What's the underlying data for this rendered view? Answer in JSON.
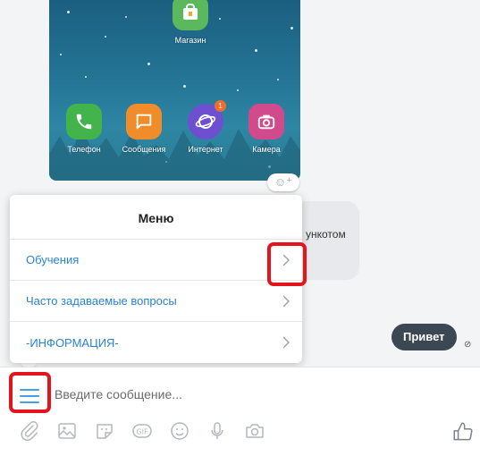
{
  "apps": [
    {
      "label": "Магазин",
      "icon": "store-icon",
      "color": "#5cb85c"
    },
    {
      "label": "Телефон",
      "icon": "phone-icon",
      "color": "#43b34b"
    },
    {
      "label": "Сообщения",
      "icon": "messages-icon",
      "color": "#f08c2a"
    },
    {
      "label": "Интернет",
      "icon": "internet-icon",
      "color": "#6e4fd0",
      "badge": "1"
    },
    {
      "label": "Камера",
      "icon": "camera-icon",
      "color": "#d14a8c"
    }
  ],
  "bot_message": {
    "text": "ункотом"
  },
  "my_message": {
    "text": "Привет"
  },
  "menu": {
    "title": "Меню",
    "items": [
      {
        "label": "Обучения"
      },
      {
        "label": "Часто задаваемые вопросы"
      },
      {
        "label": "-ИНФОРМАЦИЯ-"
      }
    ]
  },
  "composer": {
    "placeholder": "Введите сообщение...",
    "tools": [
      "paperclip-icon",
      "image-icon",
      "sticker-icon",
      "gif-icon",
      "emoji-icon",
      "microphone-icon",
      "camera-icon"
    ]
  },
  "colors": {
    "accent": "#2a82d4",
    "highlight": "#e3141b",
    "bubble_dark": "#3b4752"
  }
}
